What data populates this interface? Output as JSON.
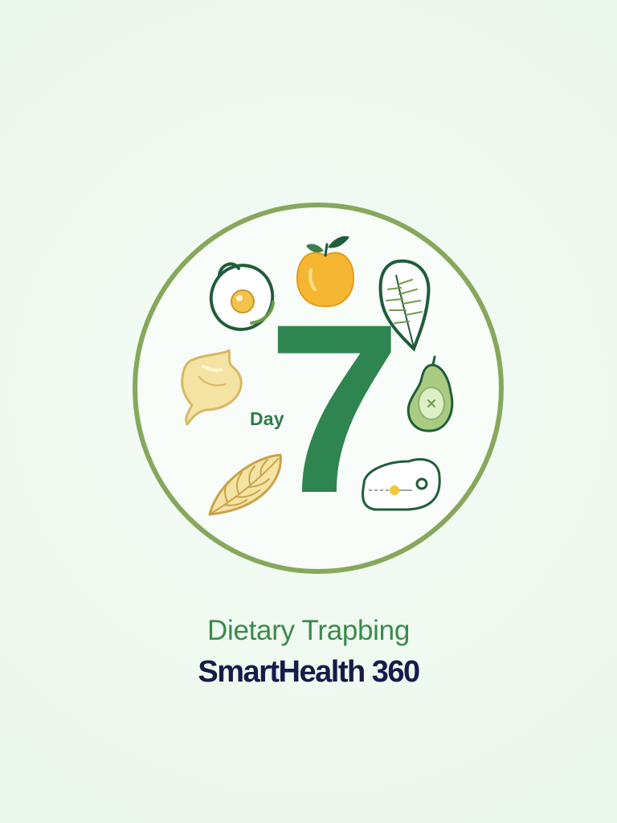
{
  "splash": {
    "day_label": "Day",
    "day_number": "7",
    "subtitle": "Dietary Trapbing",
    "brand": "SmartHealth 360"
  },
  "icons": [
    "avocado-icon",
    "apple-icon",
    "leaf-icon",
    "mushroom-icon",
    "pear-icon",
    "grain-leaf-icon",
    "health-sensor-icon"
  ],
  "colors": {
    "background": "#eff9f0",
    "ring": "#86a85c",
    "number": "#2e8550",
    "day_label": "#2e7d4a",
    "subtitle": "#3a8a4c",
    "brand": "#151c4a",
    "apple": "#f5b731",
    "pale_yellow": "#f4e3a2",
    "dark_green": "#1f5d3a",
    "light_green": "#a9cc82"
  }
}
